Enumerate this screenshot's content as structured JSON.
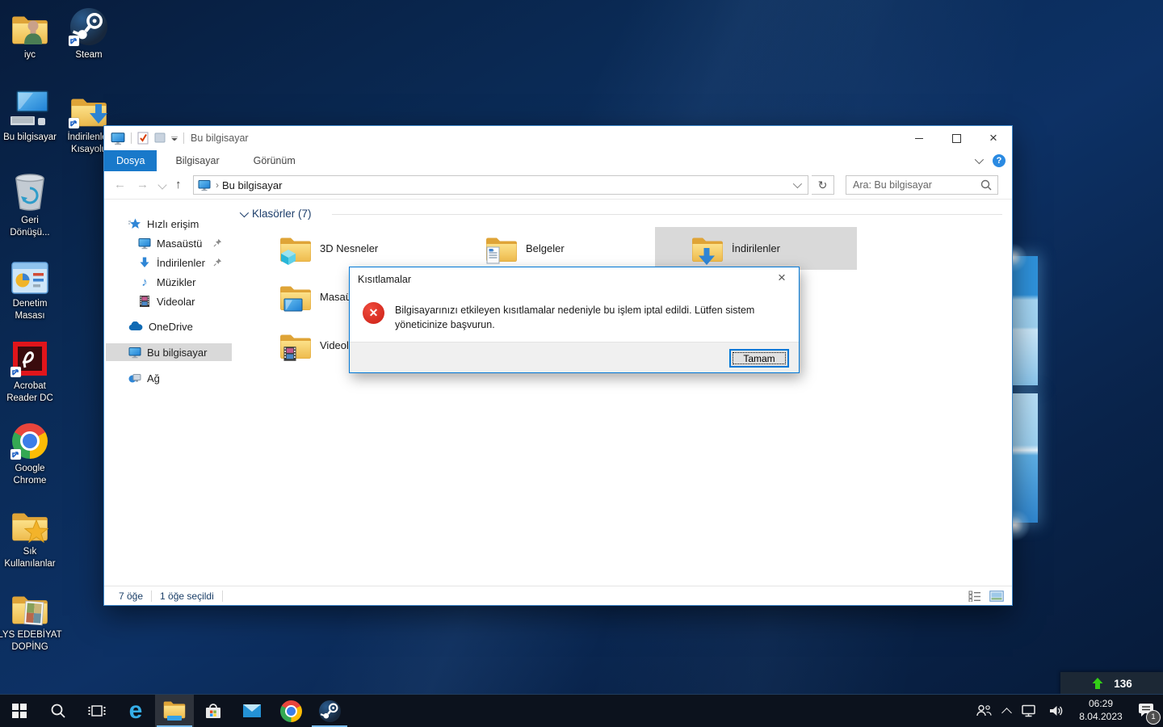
{
  "desktop": {
    "icons": [
      {
        "name": "iyc",
        "label": "iyc"
      },
      {
        "name": "steam",
        "label": "Steam"
      },
      {
        "name": "this-pc",
        "label": "Bu bilgisayar"
      },
      {
        "name": "downloads-shortcut",
        "label": "İndirilenler\nKısayolu"
      },
      {
        "name": "recycle-bin",
        "label": "Geri\nDönüşü..."
      },
      {
        "name": "control-panel",
        "label": "Denetim\nMasası"
      },
      {
        "name": "acrobat-reader",
        "label": "Acrobat\nReader DC"
      },
      {
        "name": "google-chrome",
        "label": "Google\nChrome"
      },
      {
        "name": "favorites",
        "label": "Sık\nKullanılanlar"
      },
      {
        "name": "lys-folder",
        "label": "LYS EDEBİYAT\nDOPİNG"
      }
    ]
  },
  "explorer": {
    "title": "Bu bilgisayar",
    "tabs": {
      "file": "Dosya",
      "computer": "Bilgisayar",
      "view": "Görünüm"
    },
    "address": "Bu bilgisayar",
    "search_placeholder": "Ara: Bu bilgisayar",
    "sidebar": [
      {
        "label": "Hızlı erişim"
      },
      {
        "label": "Masaüstü"
      },
      {
        "label": "İndirilenler"
      },
      {
        "label": "Müzikler"
      },
      {
        "label": "Videolar"
      },
      {
        "label": "OneDrive"
      },
      {
        "label": "Bu bilgisayar"
      },
      {
        "label": "Ağ"
      }
    ],
    "group_header": "Klasörler (7)",
    "folders": [
      {
        "name": "3D Nesneler"
      },
      {
        "name": "Belgeler"
      },
      {
        "name": "İndirilenler"
      },
      {
        "name": "Masaüstü"
      },
      {
        "name": "Videolar"
      }
    ],
    "statusbar": {
      "count": "7 öğe",
      "selected": "1 öğe seçildi"
    }
  },
  "dialog": {
    "title": "Kısıtlamalar",
    "message": "Bilgisayarınızı etkileyen kısıtlamalar nedeniyle bu işlem iptal edildi. Lütfen sistem yöneticinize başvurun.",
    "ok": "Tamam"
  },
  "net_widget": {
    "value": "136"
  },
  "taskbar": {
    "clock": {
      "time": "06:29",
      "date": "8.04.2023"
    },
    "notification_badge": "1"
  },
  "colors": {
    "accent": "#0078d7",
    "selection": "#d9d9d9",
    "taskbar": "#0c121d",
    "error_red": "#d42a1f",
    "folder_yellow": "#f7d470"
  }
}
